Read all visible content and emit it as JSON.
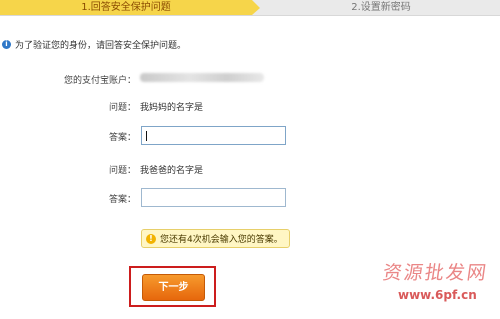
{
  "steps": {
    "step1": "1.回答安全保护问题",
    "step2": "2.设置新密码"
  },
  "info": {
    "text": "为了验证您的身份，请回答安全保护问题。"
  },
  "account": {
    "label": "您的支付宝账户："
  },
  "question1": {
    "label": "问题：",
    "text": "我妈妈的名字是",
    "answer_label": "答案：",
    "answer_value": ""
  },
  "question2": {
    "label": "问题：",
    "text": "我爸爸的名字是",
    "answer_label": "答案：",
    "answer_value": ""
  },
  "tip": {
    "text": "您还有4次机会输入您的答案。"
  },
  "next_button": {
    "label": "下一步"
  },
  "watermark": {
    "line1": "资源批发网",
    "line2": "www.6pf.cn"
  },
  "colors": {
    "active_step": "#f6d54a",
    "button": "#e6670c",
    "highlight_border": "#cc1d1d"
  }
}
